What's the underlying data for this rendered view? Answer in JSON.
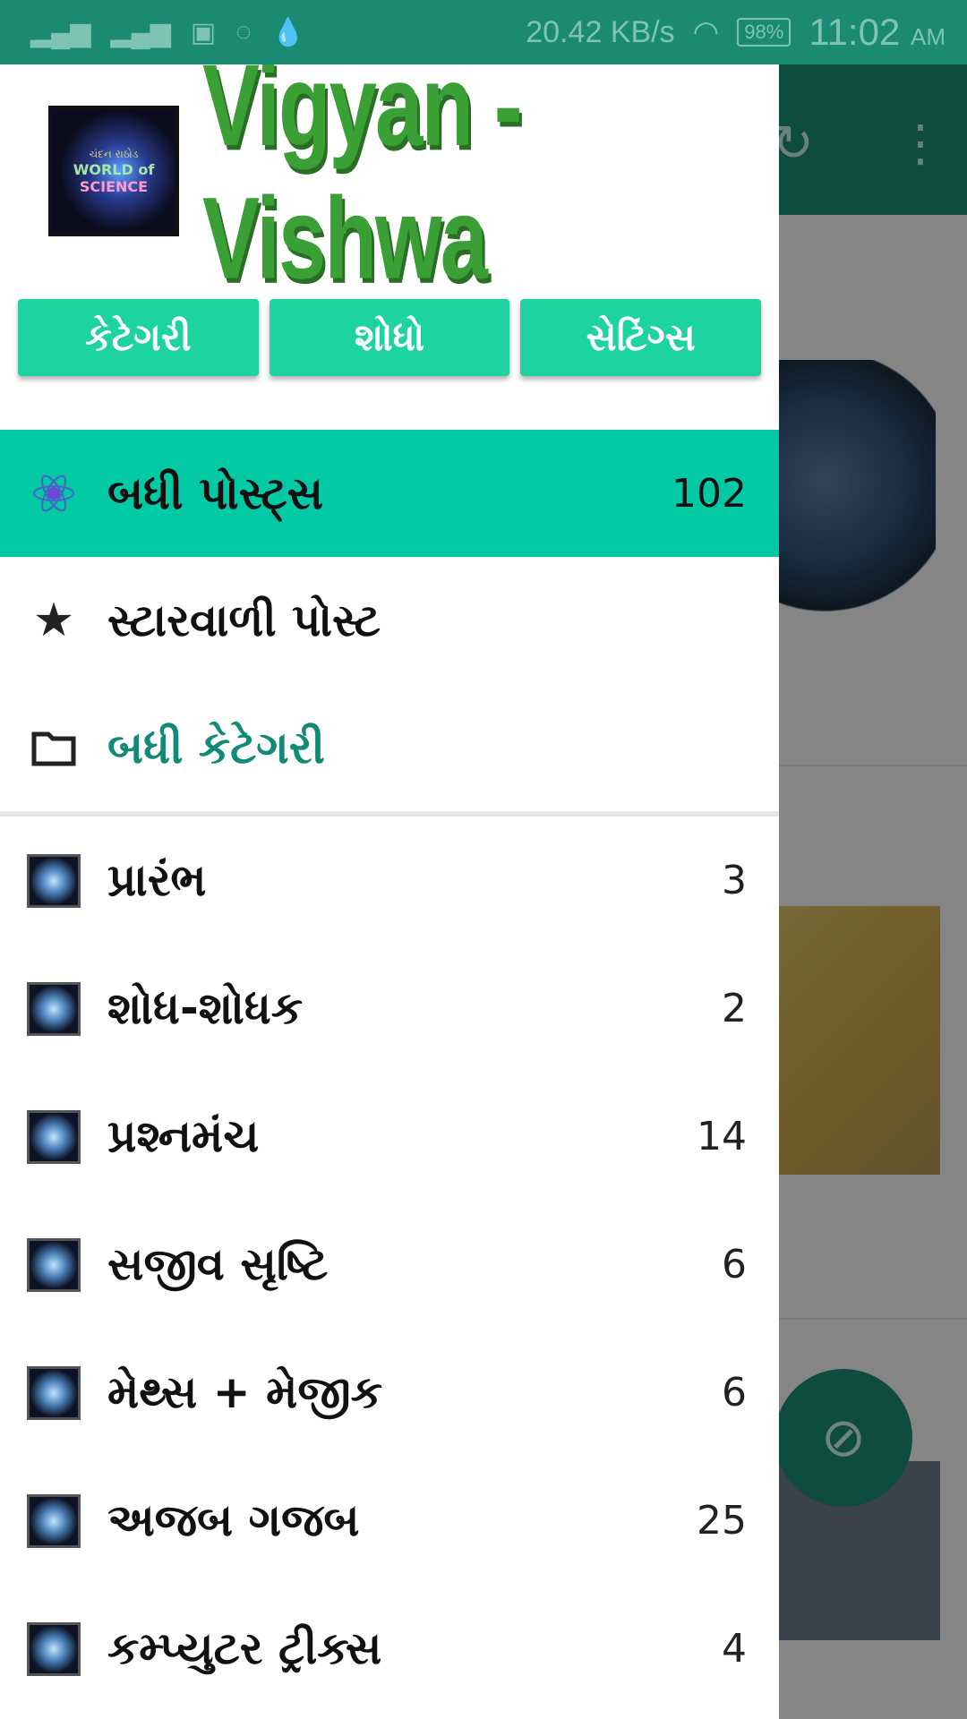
{
  "status_bar": {
    "net_speed": "20.42 KB/s",
    "battery": "98%",
    "time": "11:02",
    "ampm": "AM",
    "icons": [
      "signal-icon",
      "signal-icon",
      "image-icon",
      "chat-icon",
      "drop-icon",
      "wifi-icon"
    ]
  },
  "background": {
    "toolbar_icons": [
      "refresh-icon",
      "more-vert-icon"
    ],
    "fab_icon": "visibility-off-icon"
  },
  "drawer": {
    "logo_text": {
      "line1": "ચંદન રાઠોડ",
      "line2": "WORLD of",
      "line3": "SCIENCE"
    },
    "title": "Vigyan - Vishwa",
    "tabs": [
      {
        "label": "કેટેગરી"
      },
      {
        "label": "શોધો"
      },
      {
        "label": "સેટિંગ્સ"
      }
    ],
    "menu": {
      "all_posts": {
        "label": "બધી પોસ્ટ્સ",
        "count": "102",
        "icon": "atom-icon"
      },
      "starred": {
        "label": "સ્ટારવાળી પોસ્ટ",
        "icon": "star-icon"
      },
      "all_categories": {
        "label": "બધી કેટેગરી",
        "icon": "folder-icon"
      }
    },
    "categories": [
      {
        "label": "પ્રારંભ",
        "count": "3"
      },
      {
        "label": "શોધ-શોધક",
        "count": "2"
      },
      {
        "label": "પ્રશ્નમંચ",
        "count": "14"
      },
      {
        "label": "સજીવ સૃષ્ટિ",
        "count": "6"
      },
      {
        "label": "મેથ્સ + મેજીક",
        "count": "6"
      },
      {
        "label": "અજબ ગજબ",
        "count": "25"
      },
      {
        "label": "કમ્પ્યુટર ટ્રીક્સ",
        "count": "4"
      }
    ]
  }
}
